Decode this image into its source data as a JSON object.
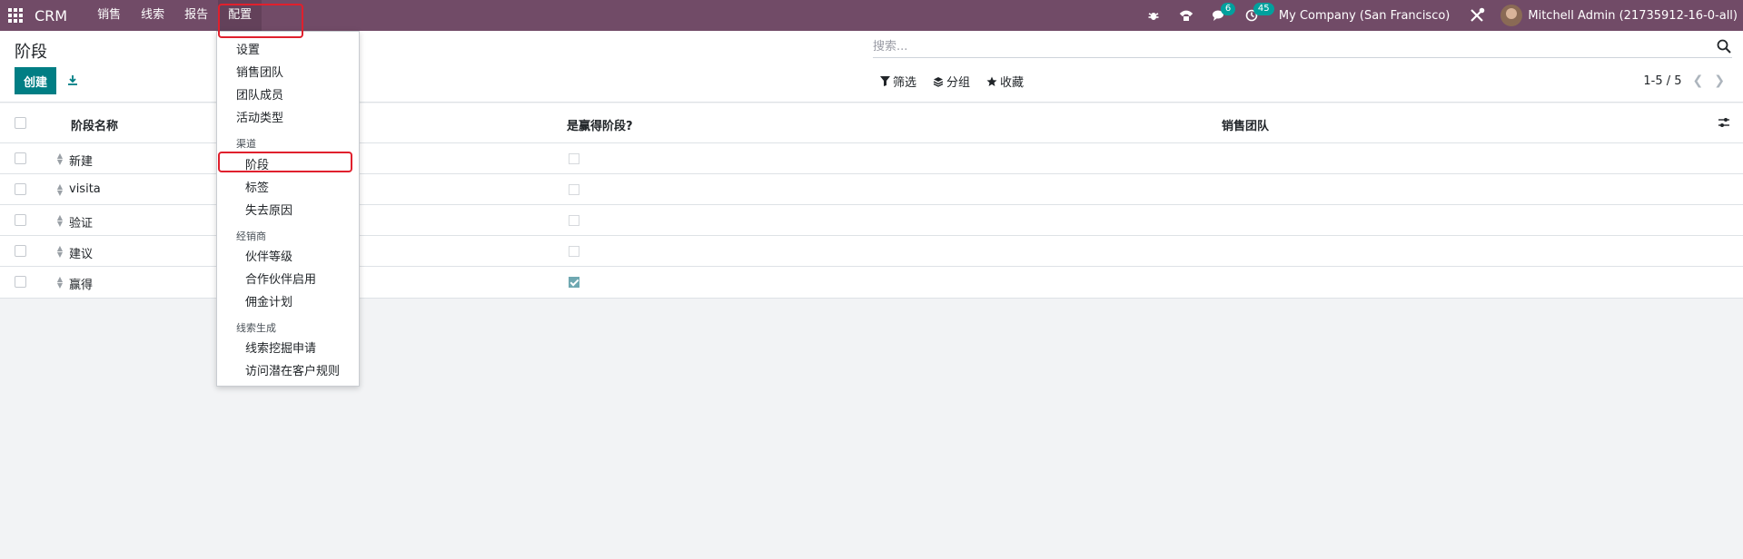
{
  "navbar": {
    "brand": "CRM",
    "menus": [
      "销售",
      "线索",
      "报告",
      "配置"
    ],
    "active_menu": "配置",
    "messages_badge": "6",
    "activities_badge": "45",
    "company": "My Company (San Francisco)",
    "user": "Mitchell Admin (21735912-16-0-all)",
    "icons": [
      "apps-grid-icon",
      "bug-icon",
      "phone-icon",
      "chat-icon",
      "clock-icon",
      "tools-icon"
    ]
  },
  "control_panel": {
    "title": "阶段",
    "create_label": "创建",
    "search_placeholder": "搜索...",
    "filter_label": "筛选",
    "groupby_label": "分组",
    "favorites_label": "收藏",
    "pager": "1-5 / 5"
  },
  "table": {
    "headers": {
      "name": "阶段名称",
      "is_won": "是赢得阶段?",
      "team": "销售团队"
    },
    "rows": [
      {
        "name": "新建",
        "is_won": false,
        "team": ""
      },
      {
        "name": "visita",
        "is_won": false,
        "team": ""
      },
      {
        "name": "验证",
        "is_won": false,
        "team": ""
      },
      {
        "name": "建议",
        "is_won": false,
        "team": ""
      },
      {
        "name": "赢得",
        "is_won": true,
        "team": ""
      }
    ]
  },
  "config_menu": {
    "items": {
      "settings": "设置",
      "sales_teams": "销售团队",
      "team_members": "团队成员",
      "activity_types": "活动类型"
    },
    "pipeline_header": "渠道",
    "pipeline": {
      "stages": "阶段",
      "tags": "标签",
      "lost_reasons": "失去原因"
    },
    "resellers_header": "经销商",
    "resellers": {
      "partner_levels": "伙伴等级",
      "partner_activations": "合作伙伴启用",
      "commission_plans": "佣金计划"
    },
    "leadgen_header": "线索生成",
    "leadgen": {
      "mining_requests": "线索挖掘申请",
      "visits_rules": "访问潜在客户规则"
    }
  },
  "highlight_color": "#e0202d",
  "brand_color": "#714b67",
  "accent_color": "#017e84"
}
